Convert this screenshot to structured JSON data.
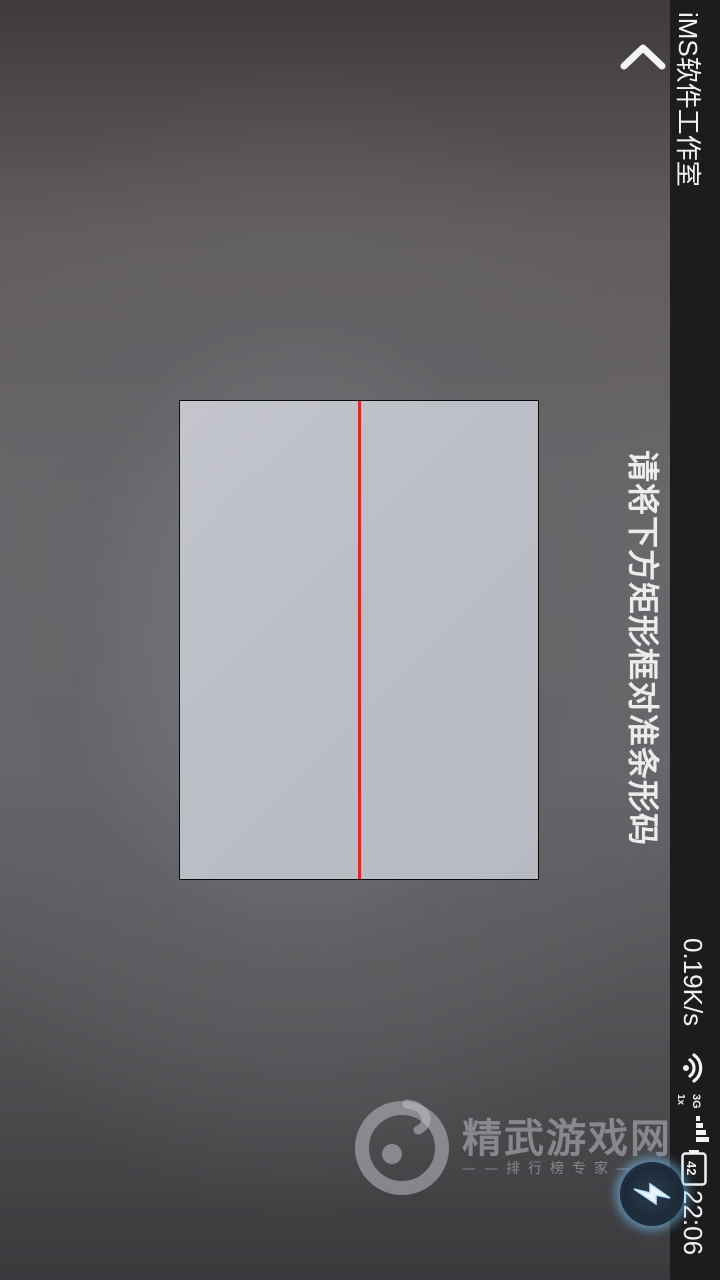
{
  "status_bar": {
    "app_title": "iMS软件工作室",
    "network_speed": "0.19K/s",
    "network_type": "3G",
    "sim_label": "1x",
    "battery_level": "42",
    "time": "22:06"
  },
  "scanner": {
    "instruction": "请将下方矩形框对准条形码",
    "scan_line_color": "#e0262a"
  },
  "watermark": {
    "name": "精武游戏网",
    "subtitle": "——排行榜专家——"
  },
  "icons": {
    "back": "chevron-up-icon",
    "flash": "lightning-icon",
    "wifi": "wifi-icon",
    "signal": "signal-icon",
    "battery": "battery-icon"
  }
}
